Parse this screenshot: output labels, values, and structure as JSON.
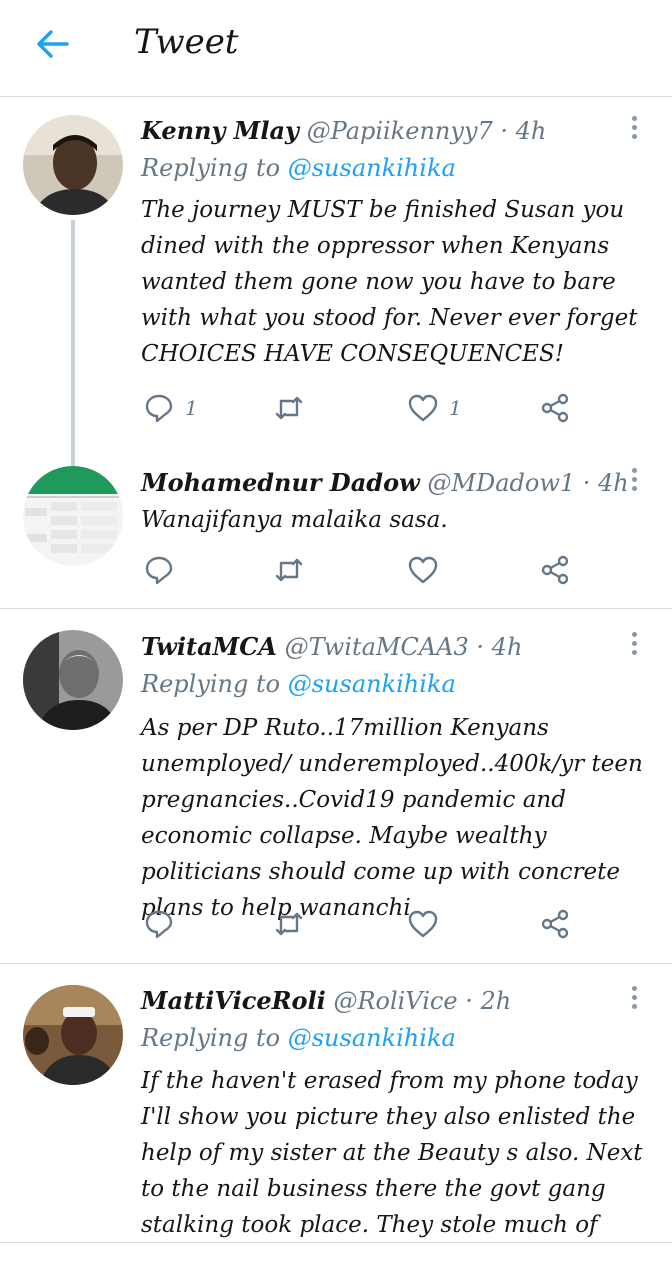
{
  "header": {
    "title": "Tweet"
  },
  "colors": {
    "accent": "#1da1f2",
    "text": "#14171a",
    "muted": "#657786"
  },
  "tweets": [
    {
      "name": "Kenny Mlay",
      "handle": "@Papiikennyy7",
      "time": "· 4h",
      "replying_prefix": "Replying to",
      "replying_to": "@susankihika",
      "text": "The journey MUST be finished Susan you dined with the oppressor when Kenyans wanted them gone now you have to bare with what you stood for. Never ever forget CHOICES HAVE CONSEQUENCES!",
      "reply_count": "1",
      "retweet_count": "",
      "like_count": "1"
    },
    {
      "name": "Mohamednur Dadow",
      "handle": "@MDadow1",
      "time": "· 4h",
      "text": "Wanajifanya malaika sasa.",
      "reply_count": "",
      "retweet_count": "",
      "like_count": ""
    },
    {
      "name": "TwitaMCA",
      "handle": "@TwitaMCAA3",
      "time": "· 4h",
      "replying_prefix": "Replying to",
      "replying_to": "@susankihika",
      "text": "As per DP Ruto..17million Kenyans unemployed/ underemployed..400k/yr teen pregnancies..Covid19 pandemic and economic collapse. Maybe wealthy politicians should come up with concrete plans to help wananchi",
      "reply_count": "",
      "retweet_count": "",
      "like_count": ""
    },
    {
      "name": "MattiViceRoli",
      "handle": "@RoliVice",
      "time": "· 2h",
      "replying_prefix": "Replying to",
      "replying_to": "@susankihika",
      "text": "If the haven't erased from my phone today I'll show you picture they also enlisted the help of my sister at the Beauty s also. Next to the nail business there the govt gang stalking took place. They stole much of remaining no digital remaking"
    }
  ]
}
